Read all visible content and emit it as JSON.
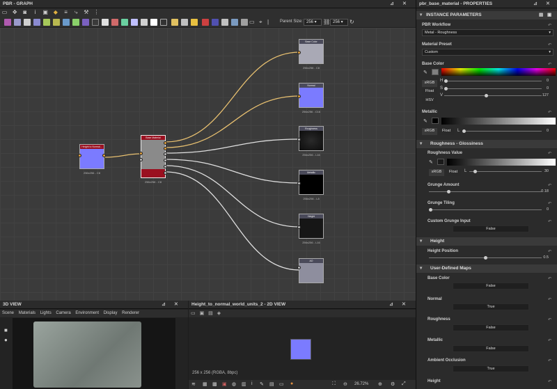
{
  "graph": {
    "title": "PBR - GRAPH",
    "parent_size_label": "Parent Size:",
    "parent_size_value": "256",
    "size_value": "256",
    "nodes": [
      {
        "name": "height-to-normal-node",
        "title": "Height to Normal...",
        "caption": "256x256 - C8",
        "color": "#7b7bff"
      },
      {
        "name": "base-material-node",
        "title": "Base Material",
        "caption": "256x256 - C8",
        "color": "#9a1020"
      },
      {
        "name": "output-basecolor-node",
        "title": "Base Color",
        "caption": "256x256 - C8",
        "color": "#a9a9b5"
      },
      {
        "name": "output-normal-node",
        "title": "Normal",
        "caption": "256x256 - C16",
        "color": "#7b7bff"
      },
      {
        "name": "output-roughness-node",
        "title": "Roughness",
        "caption": "256x256 - L16",
        "color": "#141414"
      },
      {
        "name": "output-metallic-node",
        "title": "Metallic",
        "caption": "256x256 - L8",
        "color": "#000000"
      },
      {
        "name": "output-height-node",
        "title": "Height",
        "caption": "256x256 - L16",
        "color": "#161616"
      },
      {
        "name": "output-ao-node",
        "title": "AO",
        "caption": "",
        "color": "#8e8e9e"
      }
    ]
  },
  "view3d": {
    "title": "3D VIEW",
    "menu": [
      "Scene",
      "Materials",
      "Lights",
      "Camera",
      "Environment",
      "Display",
      "Renderer"
    ]
  },
  "view2d": {
    "title": "Height_to_normal_world_units_2 - 2D VIEW",
    "info": "256 x 256 (RGBA, 8bpc)",
    "zoom": "26.72%"
  },
  "props": {
    "title": "pbr_base_material - PROPERTIES",
    "section_instance": "INSTANCE PARAMETERS",
    "pbr_workflow_label": "PBR Workflow",
    "pbr_workflow_value": "Metal - Roughness",
    "material_preset_label": "Material Preset",
    "material_preset_value": "Custom",
    "base_color_label": "Base Color",
    "srgb": "sRGB",
    "float": "Float",
    "hsv": "HSV",
    "h_label": "H",
    "h_value": "0",
    "s_label": "S",
    "s_value": "0",
    "v_label": "V",
    "v_value": "127",
    "metallic_label": "Metallic",
    "l_label": "L",
    "metallic_value": "0",
    "section_rough": "Roughness - Glossiness",
    "roughness_value_label": "Roughness Value",
    "roughness_value": "30",
    "grunge_amount_label": "Grunge Amount",
    "grunge_amount_value": "0.18",
    "grunge_tiling_label": "Grunge Tiling",
    "grunge_tiling_value": "0",
    "custom_grunge_label": "Custom Grunge Input",
    "custom_grunge_value": "False",
    "section_height": "Height",
    "height_position_label": "Height Position",
    "height_position_value": "0.5",
    "section_user": "User-Defined Maps",
    "user_maps": [
      {
        "label": "Base Color",
        "value": "False"
      },
      {
        "label": "Normal",
        "value": "True"
      },
      {
        "label": "Roughness",
        "value": "False"
      },
      {
        "label": "Metallic",
        "value": "False"
      },
      {
        "label": "Ambient Occlusion",
        "value": "True"
      },
      {
        "label": "Height",
        "value": ""
      }
    ]
  },
  "colors": {
    "accent": "#e0a040",
    "normal_blue": "#7b7bff",
    "base_red": "#9a1020"
  }
}
